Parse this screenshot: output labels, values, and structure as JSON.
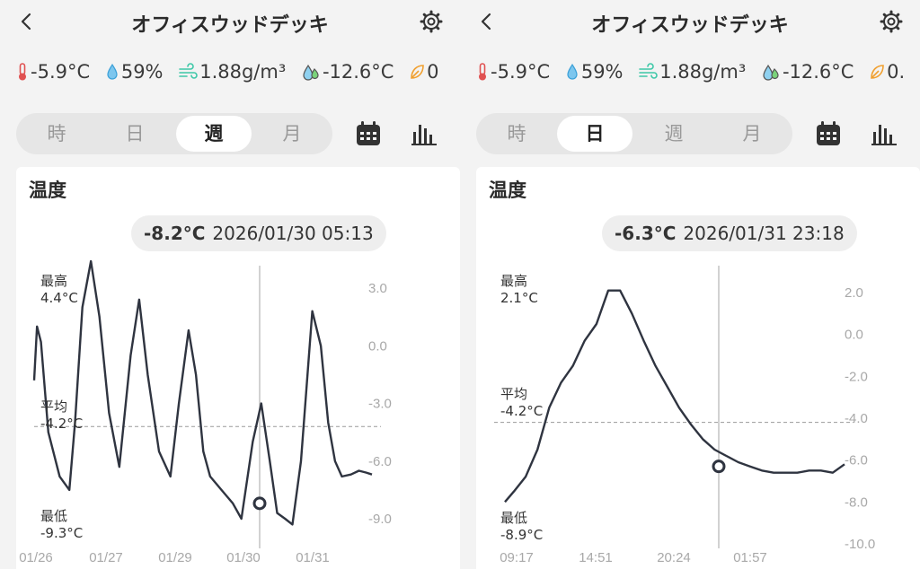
{
  "panels": [
    {
      "title": "オフィスウッドデッキ",
      "metrics": {
        "temperature": "-5.9°C",
        "humidity": "59%",
        "absolute_humidity": "1.88g/m³",
        "dew_point": "-12.6°C",
        "vpd": "0"
      },
      "tabs": [
        "時",
        "日",
        "週",
        "月"
      ],
      "active_tab": 2,
      "card_title": "温度",
      "pill_value": "-8.2°C",
      "pill_time": "2026/01/30 05:13",
      "max_label": "最高",
      "max_value": "4.4°C",
      "avg_label": "平均",
      "avg_value": "-4.2°C",
      "min_label": "最低",
      "min_value": "-9.3°C"
    },
    {
      "title": "オフィスウッドデッキ",
      "metrics": {
        "temperature": "-5.9°C",
        "humidity": "59%",
        "absolute_humidity": "1.88g/m³",
        "dew_point": "-12.6°C",
        "vpd": "0."
      },
      "tabs": [
        "時",
        "日",
        "週",
        "月"
      ],
      "active_tab": 1,
      "card_title": "温度",
      "pill_value": "-6.3°C",
      "pill_time": "2026/01/31 23:18",
      "max_label": "最高",
      "max_value": "2.1°C",
      "avg_label": "平均",
      "avg_value": "-4.2°C",
      "min_label": "最低",
      "min_value": "-8.9°C"
    }
  ],
  "chart_data": [
    {
      "type": "line",
      "title": "温度",
      "y_ticks": [
        "3.0",
        "0.0",
        "-3.0",
        "-6.0",
        "-9.0"
      ],
      "x_ticks": [
        "01/26",
        "01/27",
        "01/29",
        "01/30",
        "01/31"
      ],
      "ylim": [
        -9.3,
        4.4
      ],
      "average": -4.2,
      "selected": {
        "x": "2026/01/30 05:13",
        "y": -8.2
      },
      "series": [
        {
          "x": [
            0,
            0.05,
            0.12,
            0.25,
            0.45,
            0.62,
            0.72,
            0.85,
            1.0,
            1.15,
            1.32,
            1.5,
            1.7,
            1.85,
            2.0,
            2.2,
            2.4,
            2.55,
            2.72,
            2.85,
            2.98,
            3.1,
            3.3,
            3.5,
            3.65,
            3.85,
            4.0,
            4.15,
            4.28,
            4.42,
            4.55,
            4.7,
            4.9,
            5.05,
            5.18,
            5.3,
            5.42,
            5.58,
            5.72,
            5.85,
            5.95
          ],
          "y": [
            -1.8,
            1.0,
            0.2,
            -4.5,
            -6.8,
            -7.5,
            -4.0,
            2.0,
            4.4,
            1.5,
            -3.5,
            -6.3,
            -0.5,
            2.4,
            -1.5,
            -5.5,
            -6.8,
            -3.0,
            0.8,
            -1.5,
            -5.5,
            -6.8,
            -7.5,
            -8.2,
            -9.0,
            -5.0,
            -3.0,
            -6.0,
            -8.7,
            -9.0,
            -9.3,
            -6.0,
            1.8,
            0.0,
            -4.0,
            -6.0,
            -6.8,
            -6.7,
            -6.5,
            -6.6,
            -6.7
          ]
        }
      ]
    },
    {
      "type": "line",
      "title": "温度",
      "y_ticks": [
        "2.0",
        "0.0",
        "-2.0",
        "-4.0",
        "-6.0",
        "-8.0",
        "-10.0"
      ],
      "x_ticks": [
        "09:17",
        "14:51",
        "20:24",
        "01:57"
      ],
      "ylim": [
        -10.0,
        2.0
      ],
      "average": -4.2,
      "selected": {
        "x": "2026/01/31 23:18",
        "y": -6.3
      },
      "series": [
        {
          "x": [
            0,
            0.15,
            0.35,
            0.55,
            0.75,
            0.95,
            1.15,
            1.35,
            1.55,
            1.75,
            1.95,
            2.15,
            2.35,
            2.55,
            2.75,
            2.95,
            3.15,
            3.35,
            3.55,
            3.75,
            3.95,
            4.15,
            4.35,
            4.55,
            4.75,
            4.95,
            5.15,
            5.35,
            5.55,
            5.75
          ],
          "y": [
            -8.0,
            -7.5,
            -6.8,
            -5.5,
            -3.5,
            -2.3,
            -1.5,
            -0.3,
            0.5,
            2.1,
            2.1,
            1.0,
            -0.3,
            -1.5,
            -2.5,
            -3.5,
            -4.3,
            -5.0,
            -5.5,
            -5.8,
            -6.1,
            -6.3,
            -6.5,
            -6.6,
            -6.6,
            -6.6,
            -6.5,
            -6.5,
            -6.6,
            -6.2
          ]
        }
      ]
    }
  ]
}
